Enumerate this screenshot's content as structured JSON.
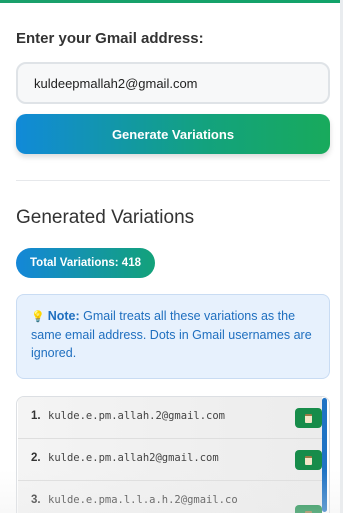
{
  "form": {
    "label": "Enter your Gmail address:",
    "email_value": "kuldeepmallah2@gmail.com",
    "generate_label": "Generate Variations"
  },
  "results": {
    "title": "Generated Variations",
    "total_badge": "Total Variations: 418",
    "note": {
      "bulb_icon": "lightbulb-icon",
      "strong": "Note:",
      "text": " Gmail treats all these variations as the same email address. Dots in Gmail usernames are ignored."
    },
    "items": [
      {
        "num": "1.",
        "email": "kulde.e.pm.allah.2@gmail.com"
      },
      {
        "num": "2.",
        "email": "kulde.e.pm.allah2@gmail.com"
      },
      {
        "num": "3.",
        "email": "kulde.e.pma.l.l.a.h.2@gmail.co"
      }
    ],
    "copy_icon": "clipboard-icon"
  },
  "colors": {
    "accent_green": "#18aa5c",
    "accent_blue": "#118ad8",
    "note_text": "#1f6fbf",
    "copy_button": "#178c4a"
  }
}
